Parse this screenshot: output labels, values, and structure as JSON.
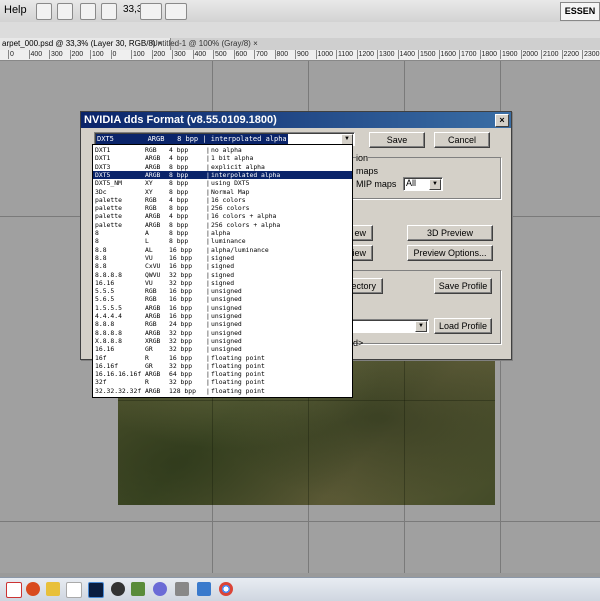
{
  "app": {
    "menu_help": "Help",
    "zoom_value": "33,3",
    "workspace_label": "ESSEN",
    "tabs": [
      {
        "label": "arpet_000.psd @ 33,3% (Layer 30, RGB/8)",
        "close": "×"
      },
      {
        "label": "Untitled-1 @ 100% (Gray/8)",
        "close": "×"
      }
    ],
    "ruler_ticks": [
      "0",
      "400",
      "300",
      "200",
      "100",
      "0",
      "100",
      "200",
      "300",
      "400",
      "500",
      "600",
      "700",
      "800",
      "900",
      "1000",
      "1100",
      "1200",
      "1300",
      "1400",
      "1500",
      "1600",
      "1700",
      "1800",
      "1900",
      "2000",
      "2100",
      "2200",
      "2300"
    ]
  },
  "dialog": {
    "title": "NVIDIA dds Format (v8.55.0109.1800)",
    "close_glyph": "×",
    "format_selected": "DXT5        ARGB   8 bpp | interpolated alpha",
    "save_label": "Save",
    "cancel_label": "Cancel",
    "mip_group_fragment": "ion",
    "mip_maps_fragment": "maps",
    "mip_count_fragment": "MIP maps",
    "mip_count_value": "All",
    "preview_left_fragment_1": "ew",
    "preview_left_fragment_2": "view",
    "btn_3d_preview": "3D Preview",
    "btn_preview_options": "Preview Options...",
    "directory_fragment": "ectory",
    "btn_save_profile": "Save Profile",
    "btn_load_profile": "Load Profile",
    "advanced_fragment": "d>"
  },
  "format_list": [
    {
      "name": "DXT1",
      "chan": "RGB",
      "bpp": "4 bpp",
      "desc": "no alpha"
    },
    {
      "name": "DXT1",
      "chan": "ARGB",
      "bpp": "4 bpp",
      "desc": "1 bit alpha"
    },
    {
      "name": "DXT3",
      "chan": "ARGB",
      "bpp": "8 bpp",
      "desc": "explicit alpha"
    },
    {
      "name": "DXT5",
      "chan": "ARGB",
      "bpp": "8 bpp",
      "desc": "interpolated alpha"
    },
    {
      "name": "DXT5_NM",
      "chan": "XY",
      "bpp": "8 bpp",
      "desc": "using DXT5"
    },
    {
      "name": "3Dc",
      "chan": "XY",
      "bpp": "8 bpp",
      "desc": "Normal Map"
    },
    {
      "name": "palette",
      "chan": "RGB",
      "bpp": "4 bpp",
      "desc": "16 colors"
    },
    {
      "name": "palette",
      "chan": "RGB",
      "bpp": "8 bpp",
      "desc": "256 colors"
    },
    {
      "name": "palette",
      "chan": "ARGB",
      "bpp": "4 bpp",
      "desc": "16 colors + alpha"
    },
    {
      "name": "palette",
      "chan": "ARGB",
      "bpp": "8 bpp",
      "desc": "256 colors + alpha"
    },
    {
      "name": "8",
      "chan": "A",
      "bpp": "8 bpp",
      "desc": "alpha"
    },
    {
      "name": "8",
      "chan": "L",
      "bpp": "8 bpp",
      "desc": "luminance"
    },
    {
      "name": "8.8",
      "chan": "AL",
      "bpp": "16 bpp",
      "desc": "alpha/luminance"
    },
    {
      "name": "8.8",
      "chan": "VU",
      "bpp": "16 bpp",
      "desc": "signed"
    },
    {
      "name": "8.8",
      "chan": "CxVU",
      "bpp": "16 bpp",
      "desc": "signed"
    },
    {
      "name": "8.8.8.8",
      "chan": "QWVU",
      "bpp": "32 bpp",
      "desc": "signed"
    },
    {
      "name": "16.16",
      "chan": "VU",
      "bpp": "32 bpp",
      "desc": "signed"
    },
    {
      "name": "5.5.5",
      "chan": "RGB",
      "bpp": "16 bpp",
      "desc": "unsigned"
    },
    {
      "name": "5.6.5",
      "chan": "RGB",
      "bpp": "16 bpp",
      "desc": "unsigned"
    },
    {
      "name": "1.5.5.5",
      "chan": "ARGB",
      "bpp": "16 bpp",
      "desc": "unsigned"
    },
    {
      "name": "4.4.4.4",
      "chan": "ARGB",
      "bpp": "16 bpp",
      "desc": "unsigned"
    },
    {
      "name": "8.8.8",
      "chan": "RGB",
      "bpp": "24 bpp",
      "desc": "unsigned"
    },
    {
      "name": "8.8.8.8",
      "chan": "ARGB",
      "bpp": "32 bpp",
      "desc": "unsigned"
    },
    {
      "name": "X.8.8.8",
      "chan": "XRGB",
      "bpp": "32 bpp",
      "desc": "unsigned"
    },
    {
      "name": "16.16",
      "chan": "GR",
      "bpp": "32 bpp",
      "desc": "unsigned"
    },
    {
      "name": "16f",
      "chan": "R",
      "bpp": "16 bpp",
      "desc": "floating point"
    },
    {
      "name": "16.16f",
      "chan": "GR",
      "bpp": "32 bpp",
      "desc": "floating point"
    },
    {
      "name": "16.16.16.16f",
      "chan": "ARGB",
      "bpp": "64 bpp",
      "desc": "floating point"
    },
    {
      "name": "32f",
      "chan": "R",
      "bpp": "32 bpp",
      "desc": "floating point"
    },
    {
      "name": "32.32.32.32f",
      "chan": "ARGB",
      "bpp": "128 bpp",
      "desc": "floating point"
    }
  ],
  "format_list_highlight_index": 3,
  "colors": {
    "title_bar": "#0a246a",
    "selection": "#0a246a",
    "dialog_face": "#d4d0c8"
  }
}
